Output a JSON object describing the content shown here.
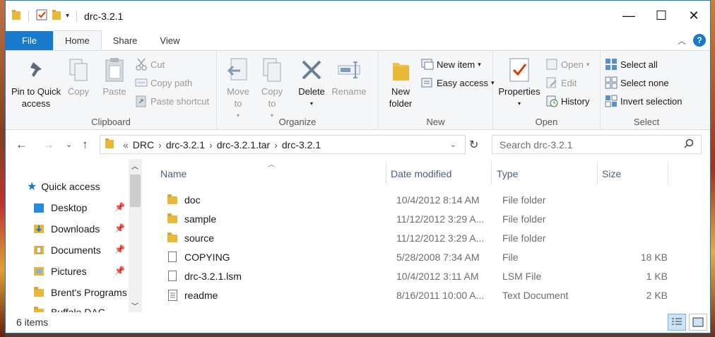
{
  "window": {
    "title": "drc-3.2.1"
  },
  "tabs": [
    {
      "label": "File"
    },
    {
      "label": "Home"
    },
    {
      "label": "Share"
    },
    {
      "label": "View"
    }
  ],
  "ribbon": {
    "clipboard": {
      "label": "Clipboard",
      "pin": "Pin to Quick access",
      "copy": "Copy",
      "paste": "Paste",
      "cut": "Cut",
      "copy_path": "Copy path",
      "paste_shortcut": "Paste shortcut"
    },
    "organize": {
      "label": "Organize",
      "move_to": "Move to",
      "copy_to": "Copy to",
      "delete": "Delete",
      "rename": "Rename"
    },
    "new": {
      "label": "New",
      "new_folder": "New folder",
      "new_item": "New item",
      "easy_access": "Easy access"
    },
    "open": {
      "label": "Open",
      "properties": "Properties",
      "open": "Open",
      "edit": "Edit",
      "history": "History"
    },
    "select": {
      "label": "Select",
      "select_all": "Select all",
      "select_none": "Select none",
      "invert": "Invert selection"
    }
  },
  "address": {
    "crumbs": [
      "DRC",
      "drc-3.2.1",
      "drc-3.2.1.tar",
      "drc-3.2.1"
    ],
    "search_placeholder": "Search drc-3.2.1"
  },
  "nav": {
    "quick_access": "Quick access",
    "items": [
      {
        "label": "Desktop",
        "pinned": true
      },
      {
        "label": "Downloads",
        "pinned": true
      },
      {
        "label": "Documents",
        "pinned": true
      },
      {
        "label": "Pictures",
        "pinned": true
      },
      {
        "label": "Brent's Programs",
        "pinned": false
      },
      {
        "label": "Buffalo DAC",
        "pinned": false
      }
    ]
  },
  "columns": {
    "name": "Name",
    "date": "Date modified",
    "type": "Type",
    "size": "Size"
  },
  "files": [
    {
      "name": "doc",
      "date": "10/4/2012 8:14 AM",
      "type": "File folder",
      "size": "",
      "icon": "folder-icon"
    },
    {
      "name": "sample",
      "date": "11/12/2012 3:29 A...",
      "type": "File folder",
      "size": "",
      "icon": "folder-icon"
    },
    {
      "name": "source",
      "date": "11/12/2012 3:29 A...",
      "type": "File folder",
      "size": "",
      "icon": "folder-icon"
    },
    {
      "name": "COPYING",
      "date": "5/28/2008 7:34 AM",
      "type": "File",
      "size": "18 KB",
      "icon": "file-icon"
    },
    {
      "name": "drc-3.2.1.lsm",
      "date": "10/4/2012 3:11 AM",
      "type": "LSM File",
      "size": "1 KB",
      "icon": "file-icon"
    },
    {
      "name": "readme",
      "date": "8/16/2011 10:00 A...",
      "type": "Text Document",
      "size": "2 KB",
      "icon": "text-document-icon"
    }
  ],
  "status": {
    "count": "6 items"
  },
  "colors": {
    "accent": "#1979ca",
    "ribbon_bg": "#f5f6f7",
    "folder": "#e8b838"
  }
}
